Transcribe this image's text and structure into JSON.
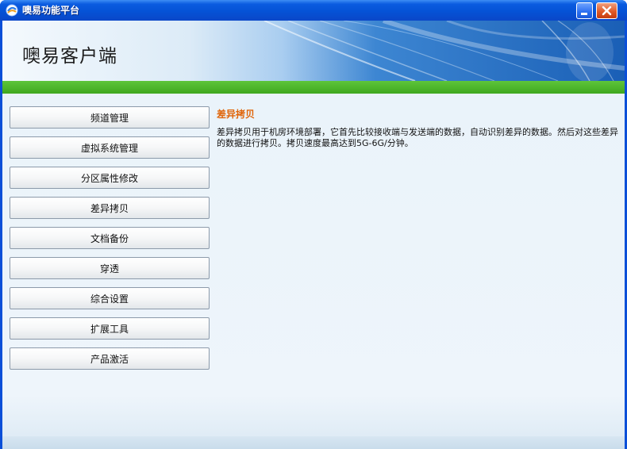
{
  "window": {
    "title": "噢易功能平台",
    "minimize_glyph": "minimize-icon",
    "close_glyph": "close-icon"
  },
  "banner": {
    "title": "噢易客户端"
  },
  "nav": {
    "items": [
      {
        "label": "频道管理"
      },
      {
        "label": "虚拟系统管理"
      },
      {
        "label": "分区属性修改"
      },
      {
        "label": "差异拷贝"
      },
      {
        "label": "文档备份"
      },
      {
        "label": "穿透"
      },
      {
        "label": "综合设置"
      },
      {
        "label": "扩展工具"
      },
      {
        "label": "产品激活"
      }
    ]
  },
  "detail": {
    "title": "差异拷贝",
    "body": "差异拷贝用于机房环境部署，它首先比较接收端与发送端的数据，自动识别差异的数据。然后对这些差异的数据进行拷贝。拷贝速度最高达到5G-6G/分钟。"
  },
  "colors": {
    "titlebar": "#0552d6",
    "accent_green": "#4cb62a",
    "detail_title": "#e0650a",
    "client_bg": "#e9f2f9"
  }
}
